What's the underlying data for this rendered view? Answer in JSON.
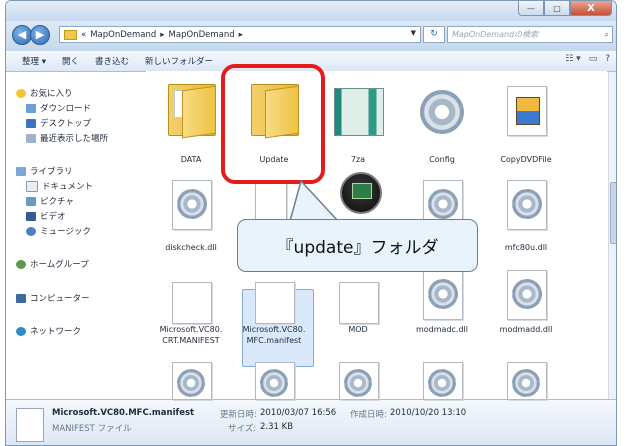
{
  "window": {
    "address": {
      "prefix": "«",
      "crumbs": [
        "MapOnDemand",
        "MapOnDemand"
      ],
      "separator": "▸"
    },
    "search_placeholder": "MapOnDemandの検索",
    "buttons": {
      "back": "◀",
      "forward": "▶",
      "refresh": "↻",
      "minimize": "—",
      "maximize": "□",
      "close": "X"
    }
  },
  "toolbar": {
    "organize": "整理 ▾",
    "open": "開く",
    "burn": "書き込む",
    "new_folder": "新しいフォルダー",
    "views": "☷ ▾",
    "preview": "▭",
    "help": "?"
  },
  "nav": {
    "favorites": "お気に入り",
    "downloads": "ダウンロード",
    "desktop": "デスクトップ",
    "recent": "最近表示した場所",
    "libraries": "ライブラリ",
    "documents": "ドキュメント",
    "pictures": "ピクチャ",
    "videos": "ビデオ",
    "music": "ミュージック",
    "homegroup": "ホームグループ",
    "computer": "コンピューター",
    "network": "ネットワーク"
  },
  "files": {
    "data": "DATA",
    "update": "Update",
    "za": "7za",
    "config": "Config",
    "copydvd": "CopyDVDFile",
    "diskcheck": "diskcheck.dll",
    "mfc80u": "mfc80u.dll",
    "crt_manifest": "Microsoft.VC80.\nCRT.MANIFEST",
    "mfc_manifest": "Microsoft.VC80.\nMFC.manifest",
    "mod": "MOD",
    "modmadc": "modmadc.dll",
    "modmadd": "modmadd.dll"
  },
  "callout": {
    "text": "『update』フォルダ"
  },
  "status": {
    "filename": "Microsoft.VC80.MFC.manifest",
    "modified_label": "更新日時:",
    "modified": "2010/03/07 16:56",
    "created_label": "作成日時:",
    "created": "2010/10/20 13:10",
    "type": "MANIFEST ファイル",
    "size_label": "サイズ:",
    "size": "2.31 KB"
  },
  "colors": {
    "highlight": "#e51c1c",
    "callout_bg": "#e8f3fb",
    "folder": "#f2d06b",
    "selection": "#d9e8fb"
  }
}
